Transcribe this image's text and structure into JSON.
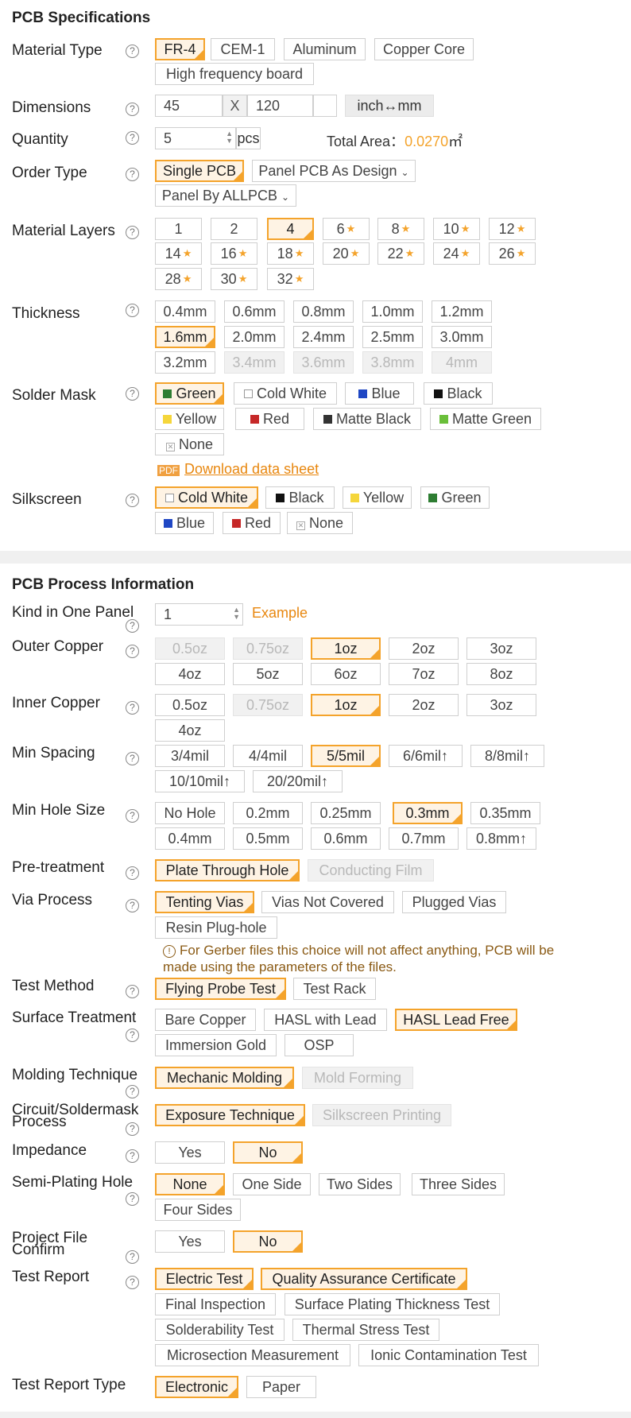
{
  "spec": {
    "title": "PCB Specifications",
    "material_type": {
      "label": "Material Type",
      "options": [
        "FR-4",
        "CEM-1",
        "Aluminum",
        "Copper Core",
        "High frequency board"
      ]
    },
    "dimensions": {
      "label": "Dimensions",
      "width": "45",
      "x": "X",
      "height": "120",
      "unit_toggle": "inch↔mm"
    },
    "quantity": {
      "label": "Quantity",
      "value": "5",
      "unit": "pcs",
      "total_area_label": "Total Area：",
      "total_area_value": "0.0270",
      "total_area_unit": "㎡"
    },
    "order_type": {
      "label": "Order Type",
      "options": [
        "Single PCB",
        "Panel PCB As Design",
        "Panel By ALLPCB"
      ]
    },
    "material_layers": {
      "label": "Material Layers",
      "options": [
        "1",
        "2",
        "4",
        "6",
        "8",
        "10",
        "12",
        "14",
        "16",
        "18",
        "20",
        "22",
        "24",
        "26",
        "28",
        "30",
        "32"
      ],
      "star": "★"
    },
    "thickness": {
      "label": "Thickness",
      "options": [
        "0.4mm",
        "0.6mm",
        "0.8mm",
        "1.0mm",
        "1.2mm",
        "1.6mm",
        "2.0mm",
        "2.4mm",
        "2.5mm",
        "3.0mm",
        "3.2mm",
        "3.4mm",
        "3.6mm",
        "3.8mm",
        "4mm"
      ]
    },
    "solder_mask": {
      "label": "Solder Mask",
      "options": [
        "Green",
        "Cold White",
        "Blue",
        "Black",
        "Yellow",
        "Red",
        "Matte Black",
        "Matte Green",
        "None"
      ],
      "download": "Download data sheet"
    },
    "silkscreen": {
      "label": "Silkscreen",
      "options": [
        "Cold White",
        "Black",
        "Yellow",
        "Green",
        "Blue",
        "Red",
        "None"
      ]
    }
  },
  "process": {
    "title": "PCB Process Information",
    "kind_in_panel": {
      "label": "Kind in One Panel",
      "value": "1",
      "example": "Example"
    },
    "outer_copper": {
      "label": "Outer Copper",
      "options": [
        "0.5oz",
        "0.75oz",
        "1oz",
        "2oz",
        "3oz",
        "4oz",
        "5oz",
        "6oz",
        "7oz",
        "8oz"
      ]
    },
    "inner_copper": {
      "label": "Inner Copper",
      "options": [
        "0.5oz",
        "0.75oz",
        "1oz",
        "2oz",
        "3oz",
        "4oz"
      ]
    },
    "min_spacing": {
      "label": "Min Spacing",
      "options": [
        "3/4mil",
        "4/4mil",
        "5/5mil",
        "6/6mil↑",
        "8/8mil↑",
        "10/10mil↑",
        "20/20mil↑"
      ]
    },
    "min_hole": {
      "label": "Min Hole Size",
      "options": [
        "No Hole",
        "0.2mm",
        "0.25mm",
        "0.3mm",
        "0.35mm",
        "0.4mm",
        "0.5mm",
        "0.6mm",
        "0.7mm",
        "0.8mm↑"
      ]
    },
    "pretreatment": {
      "label": "Pre-treatment",
      "options": [
        "Plate Through Hole",
        "Conducting Film"
      ]
    },
    "via_process": {
      "label": "Via Process",
      "options": [
        "Tenting Vias",
        "Vias Not Covered",
        "Plugged Vias",
        "Resin Plug-hole"
      ],
      "note": "For Gerber files this choice will not affect anything, PCB will be made using the parameters of the files."
    },
    "test_method": {
      "label": "Test Method",
      "options": [
        "Flying Probe Test",
        "Test Rack"
      ]
    },
    "surface": {
      "label": "Surface Treatment",
      "options": [
        "Bare Copper",
        "HASL with Lead",
        "HASL Lead Free",
        "Immersion Gold",
        "OSP"
      ]
    },
    "molding": {
      "label": "Molding Technique",
      "options": [
        "Mechanic Molding",
        "Mold Forming"
      ]
    },
    "circuit": {
      "label_1": "Circuit/Soldermask",
      "label_2": "Process",
      "options": [
        "Exposure Technique",
        "Silkscreen Printing"
      ]
    },
    "impedance": {
      "label": "Impedance",
      "options": [
        "Yes",
        "No"
      ]
    },
    "semi_plating": {
      "label": "Semi-Plating Hole",
      "options": [
        "None",
        "One Side",
        "Two Sides",
        "Three Sides",
        "Four Sides"
      ]
    },
    "project_confirm": {
      "label_1": "Project File",
      "label_2": "Confirm",
      "options": [
        "Yes",
        "No"
      ]
    },
    "test_report": {
      "label": "Test Report",
      "options": [
        "Electric Test",
        "Quality Assurance Certificate",
        "Final Inspection",
        "Surface Plating Thickness Test",
        "Solderability Test",
        "Thermal Stress Test",
        "Microsection Measurement",
        "Ionic Contamination Test"
      ]
    },
    "report_type": {
      "label": "Test Report Type",
      "options": [
        "Electronic",
        "Paper"
      ]
    }
  },
  "help_glyph": "?",
  "info_glyph": "!",
  "colors": {
    "accent": "#f4a32b",
    "link": "#e8870f",
    "green": "#2e7d32",
    "blue": "#1f47c4",
    "yellow": "#f5d63b",
    "red": "#c62828",
    "matte_black": "#333333",
    "matte_green": "#6abf3a"
  }
}
